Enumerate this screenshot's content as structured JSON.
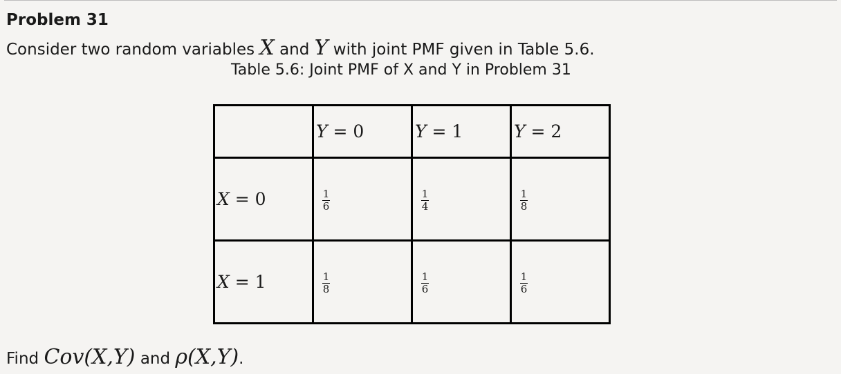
{
  "problem_title": "Problem 31",
  "intro": {
    "part1": "Consider two random variables ",
    "var_x": "X",
    "part2": " and ",
    "var_y": "Y",
    "part3": " with joint PMF given in Table 5.6."
  },
  "caption": "Table 5.6: Joint PMF of X and Y in Problem 31",
  "table": {
    "col_headers": [
      {
        "var": "Y",
        "value": "0"
      },
      {
        "var": "Y",
        "value": "1"
      },
      {
        "var": "Y",
        "value": "2"
      }
    ],
    "rows": [
      {
        "var": "X",
        "value": "0",
        "cells": [
          {
            "num": "1",
            "den": "6"
          },
          {
            "num": "1",
            "den": "4"
          },
          {
            "num": "1",
            "den": "8"
          }
        ]
      },
      {
        "var": "X",
        "value": "1",
        "cells": [
          {
            "num": "1",
            "den": "8"
          },
          {
            "num": "1",
            "den": "6"
          },
          {
            "num": "1",
            "den": "6"
          }
        ]
      }
    ]
  },
  "find": {
    "part1": "Find ",
    "cov": "Cov(X,Y)",
    "part2": " and ",
    "rho": "ρ(X,Y)",
    "part3": "."
  }
}
